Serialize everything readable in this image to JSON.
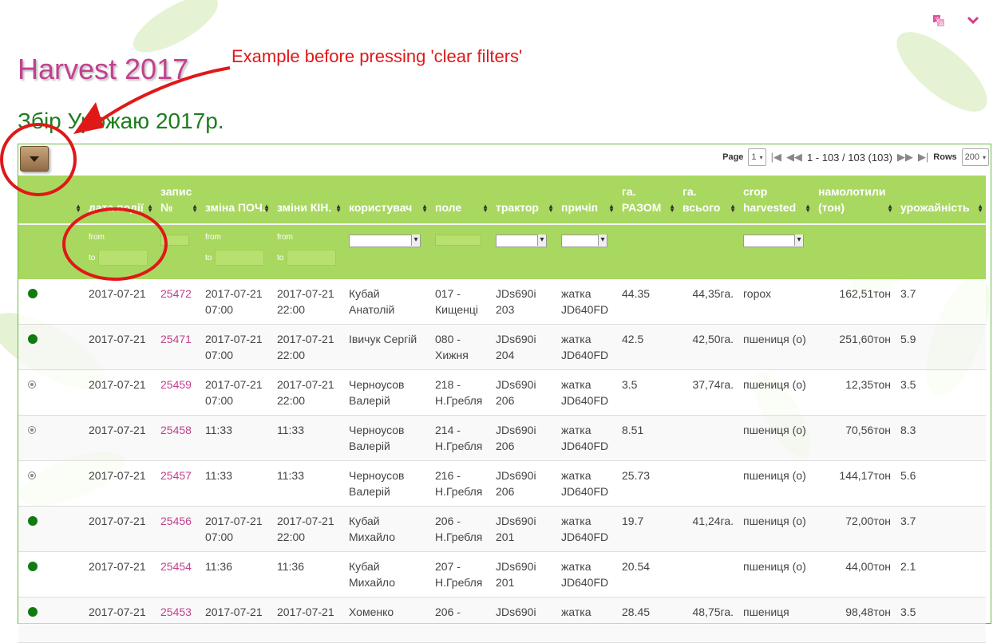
{
  "header": {
    "title": "Harvest 2017",
    "subtitle": "Збір Урожаю 2017р.",
    "language_icon": "language-icon",
    "menu_icon": "chevron-down-icon"
  },
  "annotation": {
    "text": "Example before pressing 'clear filters'"
  },
  "toolbar": {
    "filter_button_icon": "funnel-icon"
  },
  "pager": {
    "page_label": "Page",
    "page_value": "1",
    "range_text": "1 - 103 / 103 (103)",
    "rows_label": "Rows",
    "rows_value": "200"
  },
  "columns": [
    {
      "key": "status",
      "label": ""
    },
    {
      "key": "date",
      "label": "дата подiї"
    },
    {
      "key": "rec",
      "label": "запис №"
    },
    {
      "key": "shift_start",
      "label": "зміна ПОЧ."
    },
    {
      "key": "shift_end",
      "label": "зміни КІН."
    },
    {
      "key": "user",
      "label": "користувач"
    },
    {
      "key": "field",
      "label": "поле"
    },
    {
      "key": "tractor",
      "label": "трактор"
    },
    {
      "key": "trailer",
      "label": "причіп"
    },
    {
      "key": "ha_total",
      "label": "га. РАЗОМ"
    },
    {
      "key": "ha_all",
      "label": "га. всього"
    },
    {
      "key": "crop",
      "label": "crop harvested"
    },
    {
      "key": "tons",
      "label": "намолотили (тон)"
    },
    {
      "key": "yield",
      "label": "урожайність"
    }
  ],
  "filters": {
    "from_label": "from",
    "to_label": "to"
  },
  "rows": [
    {
      "status": "active",
      "date": "2017-07-21",
      "rec": "25472",
      "shift_start": "2017-07-21 07:00",
      "shift_end": "2017-07-21 22:00",
      "user": "Кубай Анатолій",
      "field": "017 - Кищенці",
      "tractor": "JDs690i 203",
      "trailer": "жатка JD640FD",
      "ha_total": "44.35",
      "ha_all": "44,35га.",
      "crop": "горох",
      "tons": "162,51тон",
      "yield": "3.7"
    },
    {
      "status": "active",
      "date": "2017-07-21",
      "rec": "25471",
      "shift_start": "2017-07-21 07:00",
      "shift_end": "2017-07-21 22:00",
      "user": "Івичук Сергій",
      "field": "080 - Хижня",
      "tractor": "JDs690i 204",
      "trailer": "жатка JD640FD",
      "ha_total": "42.5",
      "ha_all": "42,50га.",
      "crop": "пшениця (о)",
      "tons": "251,60тон",
      "yield": "5.9"
    },
    {
      "status": "closed",
      "date": "2017-07-21",
      "rec": "25459",
      "shift_start": "2017-07-21 07:00",
      "shift_end": "2017-07-21 22:00",
      "user": "Черноусов Валерій",
      "field": "218 - Н.Гребля",
      "tractor": "JDs690i 206",
      "trailer": "жатка JD640FD",
      "ha_total": "3.5",
      "ha_all": "37,74га.",
      "crop": "пшениця (о)",
      "tons": "12,35тон",
      "yield": "3.5"
    },
    {
      "status": "closed",
      "date": "2017-07-21",
      "rec": "25458",
      "shift_start": "11:33",
      "shift_end": "11:33",
      "user": "Черноусов Валерій",
      "field": "214 - Н.Гребля",
      "tractor": "JDs690i 206",
      "trailer": "жатка JD640FD",
      "ha_total": "8.51",
      "ha_all": "",
      "crop": "пшениця (о)",
      "tons": "70,56тон",
      "yield": "8.3"
    },
    {
      "status": "closed",
      "date": "2017-07-21",
      "rec": "25457",
      "shift_start": "11:33",
      "shift_end": "11:33",
      "user": "Черноусов Валерій",
      "field": "216 - Н.Гребля",
      "tractor": "JDs690i 206",
      "trailer": "жатка JD640FD",
      "ha_total": "25.73",
      "ha_all": "",
      "crop": "пшениця (о)",
      "tons": "144,17тон",
      "yield": "5.6"
    },
    {
      "status": "active",
      "date": "2017-07-21",
      "rec": "25456",
      "shift_start": "2017-07-21 07:00",
      "shift_end": "2017-07-21 22:00",
      "user": "Кубай Михайло",
      "field": "206 - Н.Гребля",
      "tractor": "JDs690i 201",
      "trailer": "жатка JD640FD",
      "ha_total": "19.7",
      "ha_all": "41,24га.",
      "crop": "пшениця (о)",
      "tons": "72,00тон",
      "yield": "3.7"
    },
    {
      "status": "active",
      "date": "2017-07-21",
      "rec": "25454",
      "shift_start": "11:36",
      "shift_end": "11:36",
      "user": "Кубай Михайло",
      "field": "207 - Н.Гребля",
      "tractor": "JDs690i 201",
      "trailer": "жатка JD640FD",
      "ha_total": "20.54",
      "ha_all": "",
      "crop": "пшениця (о)",
      "tons": "44,00тон",
      "yield": "2.1"
    },
    {
      "status": "active",
      "date": "2017-07-21",
      "rec": "25453",
      "shift_start": "2017-07-21",
      "shift_end": "2017-07-21",
      "user": "Хоменко",
      "field": "206 -",
      "tractor": "JDs690i",
      "trailer": "жатка",
      "ha_total": "28.45",
      "ha_all": "48,75га.",
      "crop": "пшениця",
      "tons": "98,48тон",
      "yield": "3.5"
    }
  ],
  "colors": {
    "header_green": "#a8d860",
    "title_pink": "#c2418f",
    "subtitle_green": "#1d7d1d",
    "annotation_red": "#e01818",
    "status_active": "#117a11"
  }
}
